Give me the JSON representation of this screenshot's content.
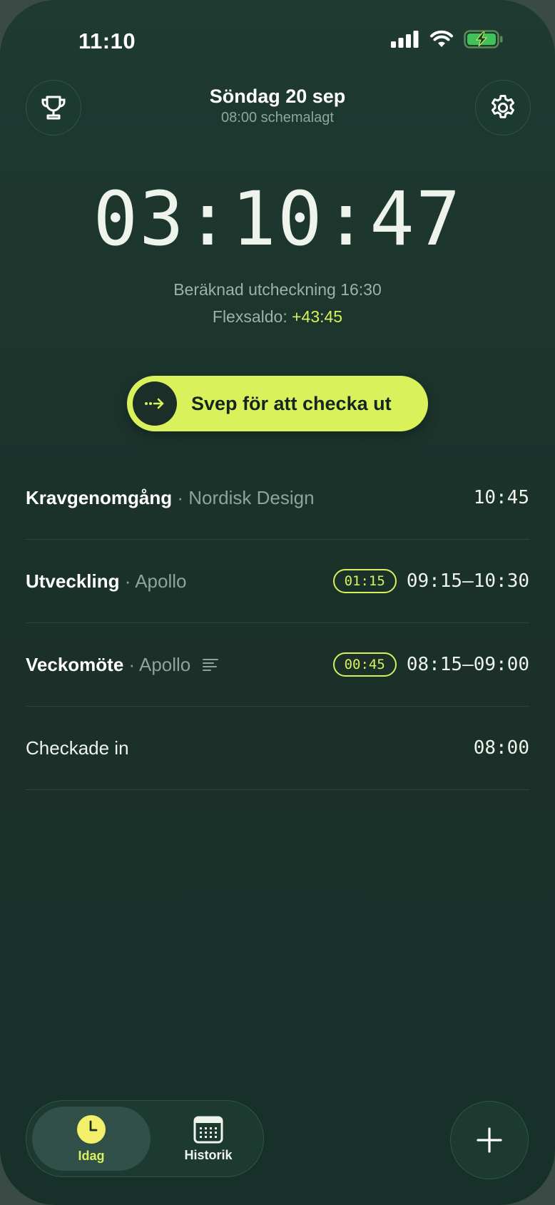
{
  "status_bar": {
    "time": "11:10"
  },
  "header": {
    "date": "Söndag 20 sep",
    "scheduled": "08:00 schemalagt",
    "left_icon": "trophy-icon",
    "right_icon": "gear-icon"
  },
  "timer": {
    "elapsed": "03:10:47",
    "estimated_checkout": "Beräknad utcheckning 16:30",
    "flex_label": "Flexsaldo:",
    "flex_value": "+43:45"
  },
  "swipe": {
    "label": "Svep för att checka ut",
    "icon": "arrow-right-icon"
  },
  "entries": [
    {
      "title": "Kravgenomgång",
      "client": "Nordisk Design",
      "duration": "",
      "time": "10:45"
    },
    {
      "title": "Utveckling",
      "client": "Apollo",
      "duration": "01:15",
      "time": "09:15–10:30"
    },
    {
      "title": "Veckomöte",
      "client": "Apollo",
      "duration": "00:45",
      "time": "08:15–09:00",
      "has_notes": true
    },
    {
      "title": "Checkade in",
      "time": "08:00"
    }
  ],
  "tabbar": {
    "today_label": "Idag",
    "history_label": "Historik"
  },
  "colors": {
    "accent": "#d8f15c",
    "background": "#1e3a31",
    "muted_text": "#8ea39a"
  }
}
